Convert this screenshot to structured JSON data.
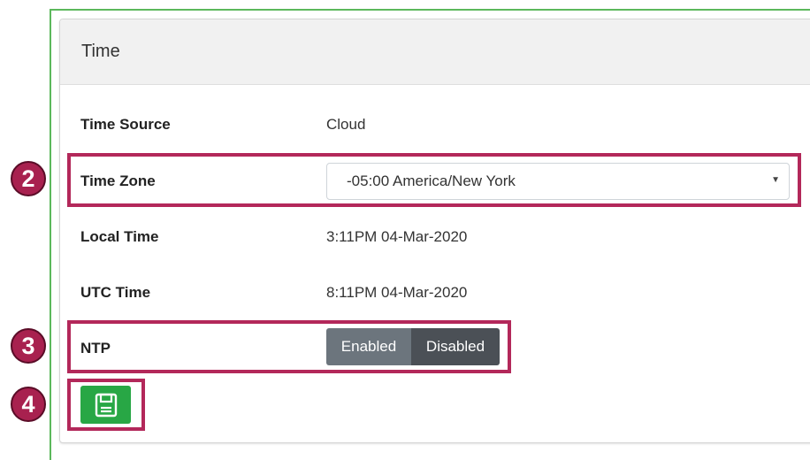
{
  "card": {
    "title": "Time"
  },
  "rows": {
    "time_source": {
      "label": "Time Source",
      "value": "Cloud"
    },
    "time_zone": {
      "label": "Time Zone",
      "value": "-05:00 America/New York"
    },
    "local_time": {
      "label": "Local Time",
      "value": "3:11PM 04-Mar-2020"
    },
    "utc_time": {
      "label": "UTC Time",
      "value": "8:11PM 04-Mar-2020"
    },
    "ntp": {
      "label": "NTP",
      "enabled_label": "Enabled",
      "disabled_label": "Disabled",
      "selected": "Disabled"
    }
  },
  "save_button": {
    "icon": "floppy-disk-icon"
  },
  "callouts": [
    "2",
    "3",
    "4"
  ],
  "colors": {
    "callout": "#b3285a",
    "save_green": "#28a745",
    "frame_green": "#5cb85c",
    "ntp_selected": "#4b5056",
    "ntp_unselected": "#6c757d"
  }
}
